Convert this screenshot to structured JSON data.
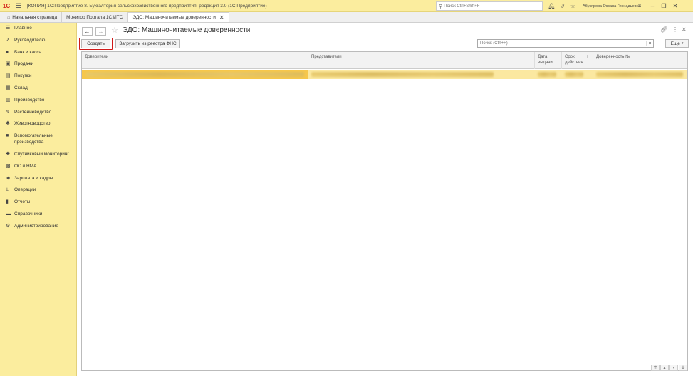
{
  "titlebar": {
    "logo": "1С",
    "title": "[КОПИЯ] 1С:Предприятие 8. Бухгалтерия сельскохозяйственного предприятия, редакция 3.0  (1С:Предприятие)",
    "search_placeholder": "Поиск Ctrl+Shift+F",
    "user": "Абузярова Оксана Геннадьевна"
  },
  "tabs": [
    {
      "label": "Начальная страница",
      "icon": "home-icon"
    },
    {
      "label": "Монитор Портала 1С:ИТС"
    },
    {
      "label": "ЭДО: Машиночитаемые доверенности",
      "active": true
    }
  ],
  "sidebar": {
    "items": [
      {
        "label": "Главное",
        "icon": "menu-lines-icon"
      },
      {
        "label": "Руководителю",
        "icon": "trend-icon"
      },
      {
        "label": "Банк и касса",
        "icon": "coin-icon"
      },
      {
        "label": "Продажи",
        "icon": "cart-icon"
      },
      {
        "label": "Покупки",
        "icon": "basket-icon"
      },
      {
        "label": "Склад",
        "icon": "warehouse-icon"
      },
      {
        "label": "Производство",
        "icon": "factory-icon"
      },
      {
        "label": "Растениеводство",
        "icon": "leaf-icon"
      },
      {
        "label": "Животноводство",
        "icon": "animal-icon"
      },
      {
        "label": "Вспомогательные производства",
        "icon": "tractor-icon"
      },
      {
        "label": "Спутниковый мониторинг",
        "icon": "satellite-icon"
      },
      {
        "label": "ОС и НМА",
        "icon": "building-icon"
      },
      {
        "label": "Зарплата и кадры",
        "icon": "people-icon"
      },
      {
        "label": "Операции",
        "icon": "operations-icon"
      },
      {
        "label": "Отчеты",
        "icon": "chart-icon"
      },
      {
        "label": "Справочники",
        "icon": "book-icon"
      },
      {
        "label": "Администрирование",
        "icon": "gear-icon"
      }
    ]
  },
  "main": {
    "title": "ЭДО: Машиночитаемые доверенности",
    "create_label": "Создать",
    "load_label": "Загрузить из реестра ФНС",
    "search_placeholder": "Поиск (Ctrl+F)",
    "more_label": "Еще",
    "columns": {
      "c1": "Доверители",
      "c2": "Представители",
      "c3": "Дата выдачи",
      "c4": "Срок действия",
      "c5": "Доверенность №"
    }
  },
  "colors": {
    "accent_yellow": "#fbed9e",
    "selected_row": "#fbe8a0",
    "highlight_red": "#d01a1a"
  }
}
